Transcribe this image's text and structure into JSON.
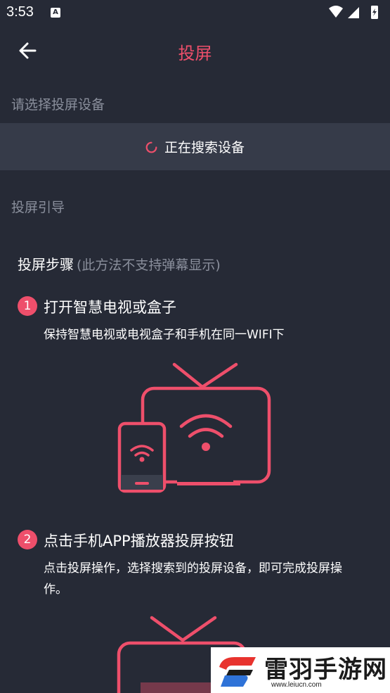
{
  "status_bar": {
    "time": "3:53",
    "notification_icon": "A"
  },
  "header": {
    "title": "投屏",
    "back_icon": "arrow-left-icon"
  },
  "device_section": {
    "label": "请选择投屏设备",
    "searching_text": "正在搜索设备"
  },
  "guide_section": {
    "label": "投屏引导"
  },
  "steps": {
    "title": "投屏步骤",
    "note": "(此方法不支持弹幕显示)",
    "items": [
      {
        "number": "1",
        "title": "打开智慧电视或盒子",
        "desc": "保持智慧电视或电视盒子和手机在同一WIFI下"
      },
      {
        "number": "2",
        "title": "点击手机APP播放器投屏按钮",
        "desc": "点击投屏操作，选择搜索到的投屏设备，即可完成投屏操作。"
      }
    ]
  },
  "watermark": {
    "text": "雷羽手游网",
    "url": "www.leiucn.com"
  },
  "colors": {
    "accent": "#ee4f6b",
    "background": "#262a36",
    "panel": "#363b49",
    "muted": "#8a8f9c"
  }
}
